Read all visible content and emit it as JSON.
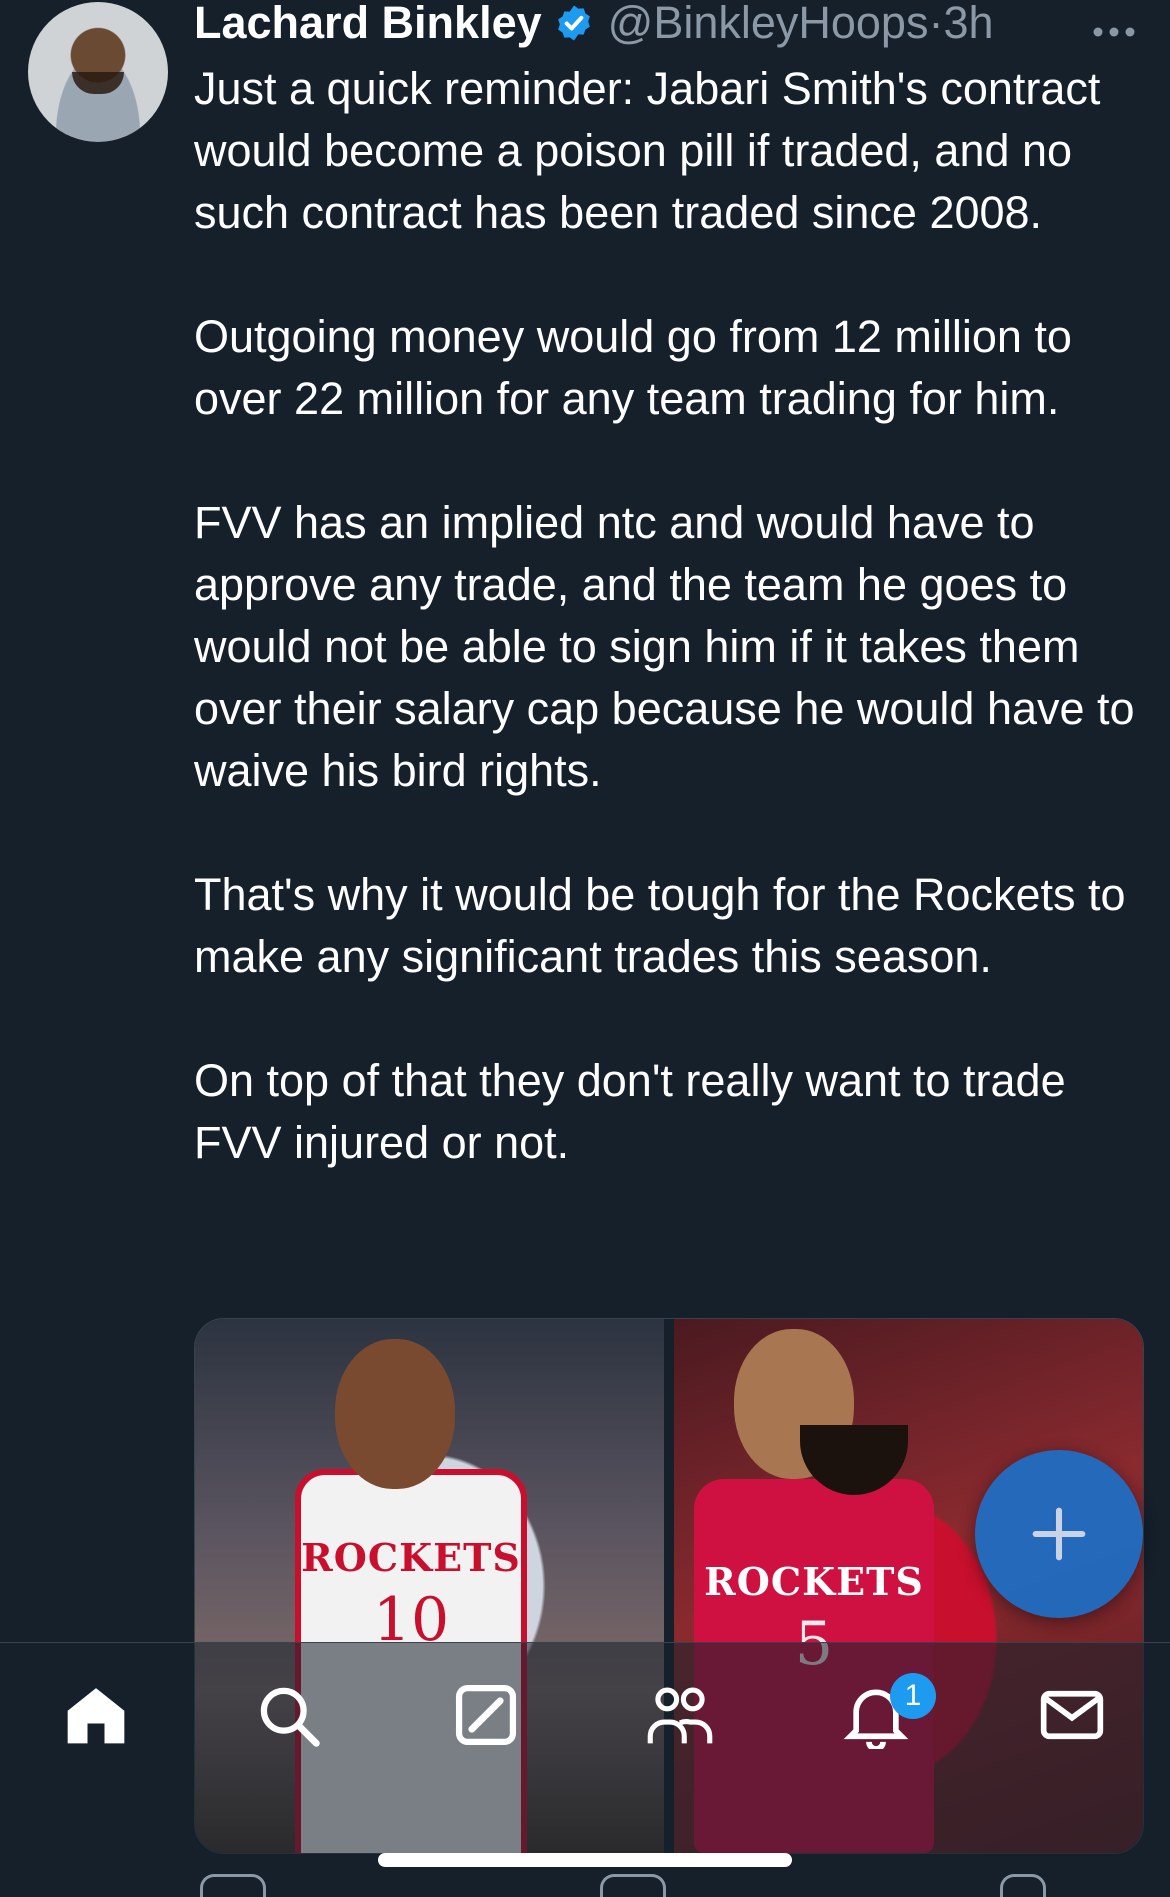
{
  "tweet": {
    "author": {
      "display_name": "Lachard Binkley",
      "verified": true,
      "handle": "@BinkleyHoops",
      "separator": "·",
      "time": "3h"
    },
    "more_icon": "more-horizontal-icon",
    "paragraphs": [
      "Just a quick reminder: Jabari Smith's contract would become a poison pill if traded, and no such contract has been traded since 2008.",
      "Outgoing money would go from 12 million to over 22 million for any team trading for him.",
      "FVV has an implied ntc and would have to approve any trade, and the team he goes to would not be able to sign him if it takes them over their salary cap because he would have to waive his bird rights.",
      "That's why it would be tough for the Rockets to make any significant trades this season.",
      "On top of that they don't really want to trade FVV injured or not."
    ],
    "media": [
      {
        "jersey_text": "ROCKETS",
        "jersey_number": "10"
      },
      {
        "jersey_text": "ROCKETS",
        "jersey_number": "5"
      }
    ]
  },
  "fab": {
    "icon": "compose-plus-icon"
  },
  "tabbar": {
    "items": [
      {
        "icon": "home-icon"
      },
      {
        "icon": "search-icon"
      },
      {
        "icon": "grok-icon"
      },
      {
        "icon": "communities-icon"
      },
      {
        "icon": "notifications-icon",
        "badge": "1"
      },
      {
        "icon": "messages-icon"
      }
    ]
  },
  "colors": {
    "background": "#15202b",
    "text_primary": "#ffffff",
    "text_secondary": "#8b98a5",
    "accent": "#1d9bf0",
    "fab": "#1d6fc6"
  }
}
